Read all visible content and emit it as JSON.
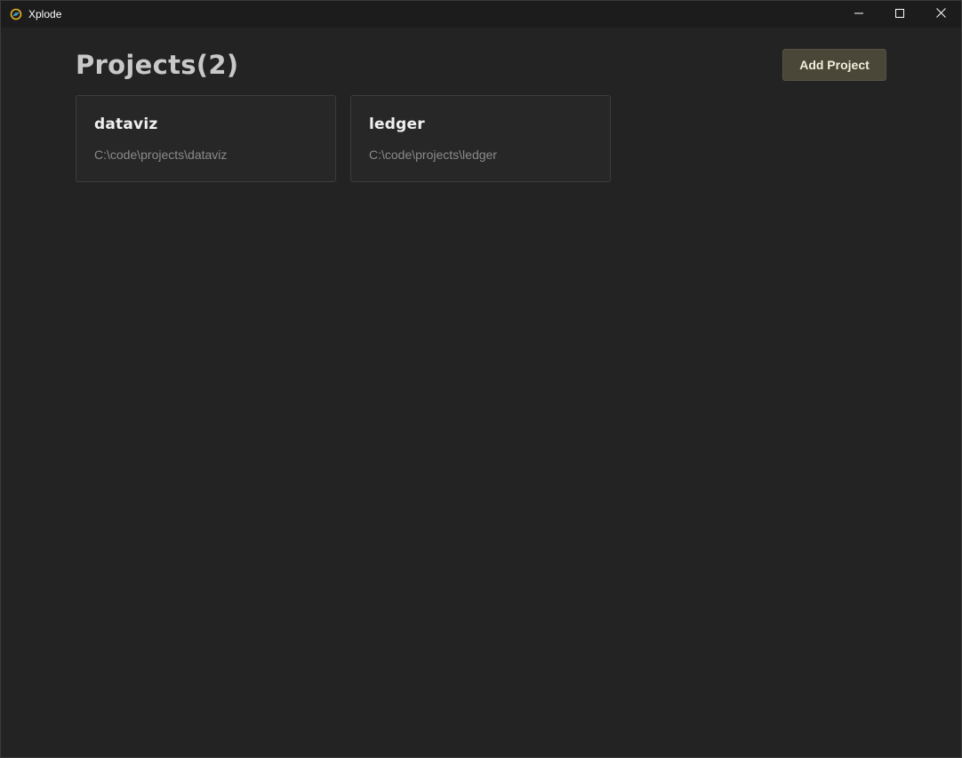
{
  "window": {
    "title": "Xplode",
    "controls": {
      "minimize": "minimize-icon",
      "maximize": "maximize-icon",
      "close": "close-icon"
    }
  },
  "header": {
    "title": "Projects(2)",
    "add_button_label": "Add Project"
  },
  "projects": [
    {
      "name": "dataviz",
      "path": "C:\\code\\projects\\dataviz"
    },
    {
      "name": "ledger",
      "path": "C:\\code\\projects\\ledger"
    }
  ],
  "colors": {
    "background": "#232323",
    "titlebar": "#1c1c1c",
    "accent_button": "#4a4638",
    "accent_text": "#f2efdc",
    "app_icon_yellow": "#e6b422",
    "app_icon_blue": "#3fa9d6"
  }
}
